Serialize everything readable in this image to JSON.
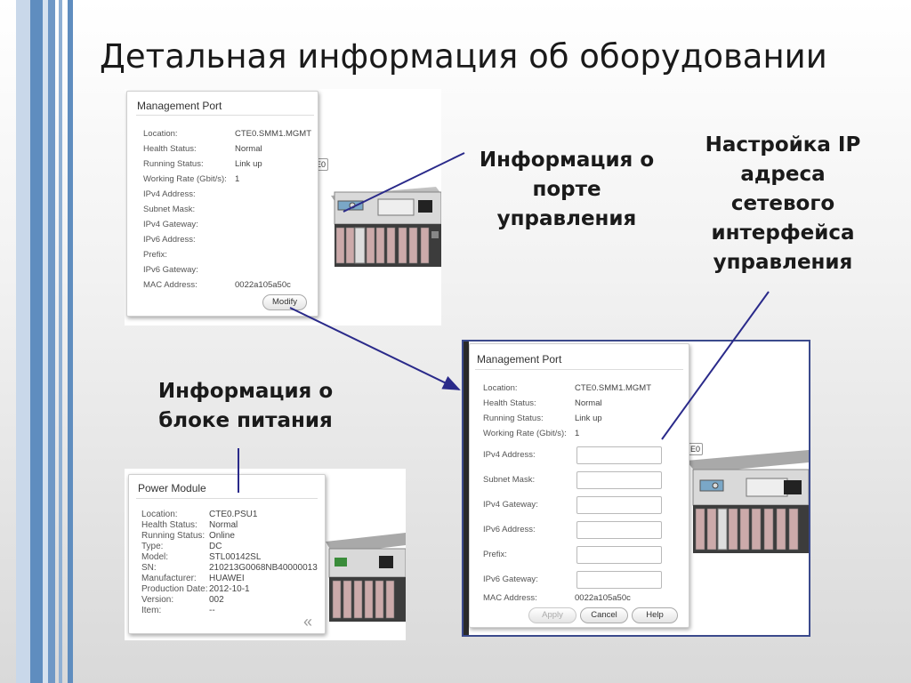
{
  "slide": {
    "title": "Детальная информация об оборудовании",
    "colors": {
      "accent_stripe_light": "#c5d5e8",
      "accent_stripe_dark": "#5a88bb",
      "arrow": "#2a2a8a",
      "frame": "#3b4a8c"
    }
  },
  "captions": {
    "mgmt_port_info": [
      "Информация о",
      "порте",
      "управления"
    ],
    "ip_settings": [
      "Настройка IP",
      "адреса",
      "сетевого",
      "интерфейса",
      "управления"
    ],
    "power_info": [
      "Информация о",
      "блоке питания"
    ]
  },
  "mgmt_port_panel": {
    "title": "Management Port",
    "fields": [
      {
        "label": "Location:",
        "value": "CTE0.SMM1.MGMT"
      },
      {
        "label": "Health Status:",
        "value": "Normal"
      },
      {
        "label": "Running Status:",
        "value": "Link up"
      },
      {
        "label": "Working Rate (Gbit/s):",
        "value": "1"
      },
      {
        "label": "IPv4 Address:",
        "value": ""
      },
      {
        "label": "Subnet Mask:",
        "value": ""
      },
      {
        "label": "IPv4 Gateway:",
        "value": ""
      },
      {
        "label": "IPv6 Address:",
        "value": ""
      },
      {
        "label": "Prefix:",
        "value": ""
      },
      {
        "label": "IPv6 Gateway:",
        "value": ""
      },
      {
        "label": "MAC Address:",
        "value": "0022a105a50c"
      }
    ],
    "modify_button": "Modify",
    "behind_tag": "E0"
  },
  "mgmt_port_edit": {
    "title": "Management Port",
    "fields": [
      {
        "label": "Location:",
        "value": "CTE0.SMM1.MGMT"
      },
      {
        "label": "Health Status:",
        "value": "Normal"
      },
      {
        "label": "Running Status:",
        "value": "Link up"
      },
      {
        "label": "Working Rate (Gbit/s):",
        "value": "1"
      },
      {
        "label": "MAC Address:",
        "value": "0022a105a50c"
      }
    ],
    "inputs": [
      {
        "label": "IPv4 Address:",
        "value": ""
      },
      {
        "label": "Subnet Mask:",
        "value": ""
      },
      {
        "label": "IPv4 Gateway:",
        "value": ""
      },
      {
        "label": "IPv6 Address:",
        "value": ""
      },
      {
        "label": "Prefix:",
        "value": ""
      },
      {
        "label": "IPv6 Gateway:",
        "value": ""
      }
    ],
    "buttons": {
      "apply": "Apply",
      "cancel": "Cancel",
      "help": "Help"
    },
    "behind_tag": "E0"
  },
  "power_module": {
    "title": "Power Module",
    "fields": [
      {
        "label": "Location:",
        "value": "CTE0.PSU1"
      },
      {
        "label": "Health Status:",
        "value": "Normal"
      },
      {
        "label": "Running Status:",
        "value": "Online"
      },
      {
        "label": "Type:",
        "value": "DC"
      },
      {
        "label": "Model:",
        "value": "STL00142SL"
      },
      {
        "label": "SN:",
        "value": "210213G0068NB40000013"
      },
      {
        "label": "Manufacturer:",
        "value": "HUAWEI"
      },
      {
        "label": "Production Date:",
        "value": "2012-10-1"
      },
      {
        "label": "Version:",
        "value": "002"
      },
      {
        "label": "Item:",
        "value": "--"
      }
    ],
    "collapse_icon": "double-chevron-left-icon"
  }
}
